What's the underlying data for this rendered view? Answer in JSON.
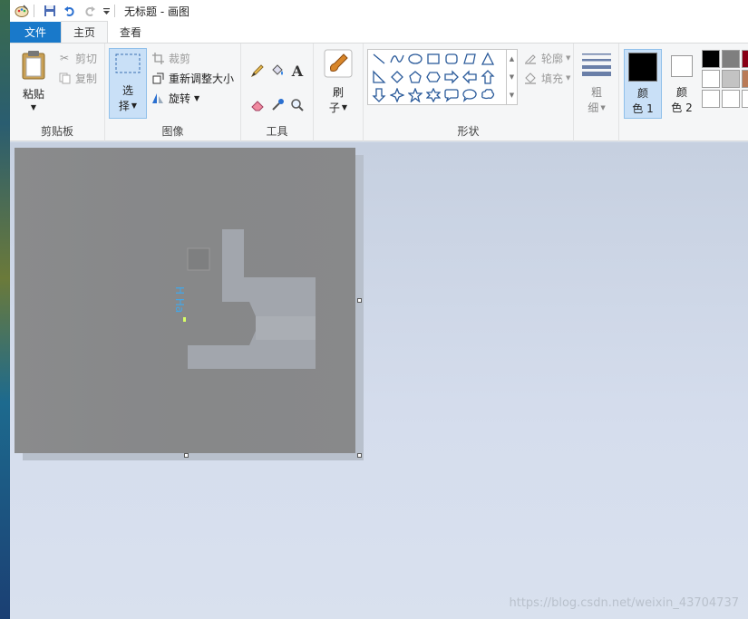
{
  "titlebar": {
    "title": "无标题 - 画图"
  },
  "tabs": {
    "file": "文件",
    "home": "主页",
    "view": "查看"
  },
  "clipboard": {
    "paste": "粘贴",
    "cut": "剪切",
    "copy": "复制",
    "group": "剪贴板"
  },
  "image": {
    "select_line1": "选",
    "select_line2": "择",
    "crop": "裁剪",
    "resize": "重新调整大小",
    "rotate": "旋转",
    "group": "图像"
  },
  "tools": {
    "group": "工具"
  },
  "brushes": {
    "line1": "刷",
    "line2": "子"
  },
  "shapes": {
    "outline": "轮廓",
    "fill": "填充",
    "group": "形状"
  },
  "size": {
    "line1": "粗",
    "line2": "细"
  },
  "color1": {
    "line1": "颜",
    "line2": "色 1",
    "value": "#000000"
  },
  "color2": {
    "line1": "颜",
    "line2": "色 2",
    "value": "#ffffff"
  },
  "palette": [
    "#000000",
    "#7f7f7f",
    "#880015",
    "#ffffff",
    "#c3c3c3",
    "#b97a57",
    "#ffffff",
    "#ffffff",
    "#ffffff"
  ],
  "canvas": {
    "vertical_text": "H Ha",
    "highlight_text": "4"
  },
  "watermark": "https://blog.csdn.net/weixin_43704737"
}
